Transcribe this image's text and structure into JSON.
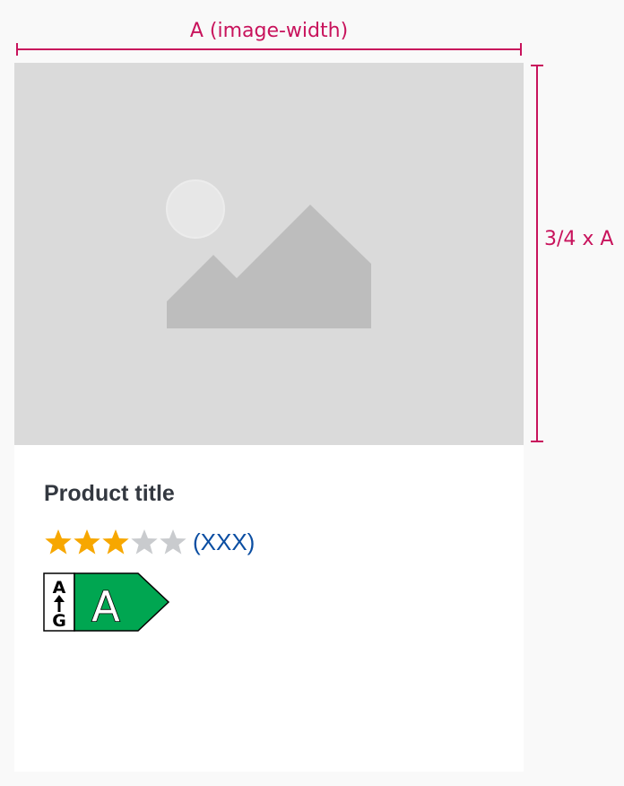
{
  "dimensions": {
    "width_label": "A (image-width)",
    "height_label": "3/4 x A",
    "color": "#c8135c"
  },
  "card": {
    "image": {
      "icon": "image-placeholder-icon",
      "background": "#dadada"
    },
    "title": "Product title",
    "rating": {
      "value": 3,
      "max": 5,
      "count_text": "(XXX)",
      "filled_color": "#f7a700",
      "empty_color": "#c9cbce"
    },
    "energy_label": {
      "scale_top": "A",
      "scale_bottom": "G",
      "class": "A",
      "color": "#00a651"
    }
  }
}
